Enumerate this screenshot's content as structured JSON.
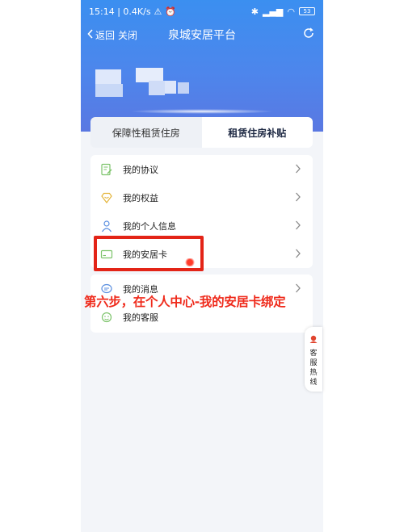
{
  "status_bar": {
    "time_speed": "15:14 | 0.4K/s",
    "battery": "53"
  },
  "nav": {
    "back_label": "返回",
    "close_label": "关闭",
    "title": "泉城安居平台"
  },
  "tabs": [
    {
      "label": "保障性租赁住房",
      "active": false
    },
    {
      "label": "租赁住房补贴",
      "active": true
    }
  ],
  "menu_group_1": [
    {
      "label": "我的协议",
      "icon": "agreement-icon"
    },
    {
      "label": "我的权益",
      "icon": "benefits-icon"
    },
    {
      "label": "我的个人信息",
      "icon": "person-icon"
    },
    {
      "label": "我的安居卡",
      "icon": "card-icon"
    }
  ],
  "menu_group_2": [
    {
      "label": "我的消息",
      "icon": "message-icon"
    },
    {
      "label": "我的客服",
      "icon": "customer-service-icon"
    }
  ],
  "overlay": {
    "instruction": "第六步，在个人中心-我的安居卡绑定"
  },
  "service_float": {
    "label": "客服热线"
  },
  "colors": {
    "header": "#4d86ec",
    "highlight": "#e32417",
    "instruction": "#ef2b1c"
  }
}
